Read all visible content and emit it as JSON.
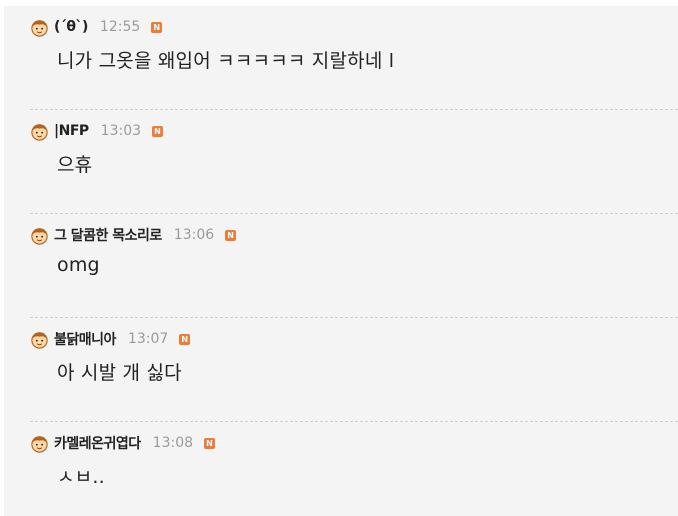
{
  "comments": [
    {
      "nick": "(´θ`)",
      "time": "12:55",
      "badge": "N",
      "text": "니가 그옷을 왜입어 ㅋㅋㅋㅋㅋ 지랄하네 l"
    },
    {
      "nick": "|NFP",
      "time": "13:03",
      "badge": "N",
      "text": "으휴"
    },
    {
      "nick": "그 달콤한 목소리로",
      "time": "13:06",
      "badge": "N",
      "text": "omg"
    },
    {
      "nick": "불닭매니아",
      "time": "13:07",
      "badge": "N",
      "text": "아 시발 개 싫다"
    },
    {
      "nick": "카멜레온귀엽다",
      "time": "13:08",
      "badge": "N",
      "text": "ㅅㅂ.."
    }
  ],
  "colors": {
    "background": "#f4f4f4",
    "nickname": "#222222",
    "timestamp": "#9b9b9b",
    "new_badge": "#ee7b37",
    "avatar_hair": "#b4621e",
    "avatar_face": "#ffd9a8"
  },
  "icons": {
    "avatar": "cartoon-boy-avatar-icon",
    "new_badge": "new-badge-icon"
  }
}
